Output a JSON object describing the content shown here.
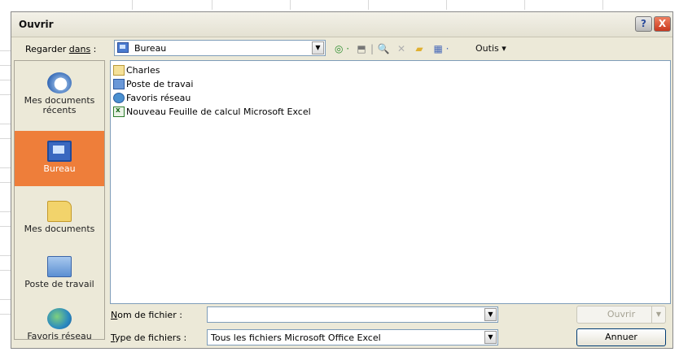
{
  "dialog": {
    "title": "Ouvrir",
    "help_label": "?",
    "close_label": "X"
  },
  "look_in": {
    "label_prefix": "Regarder ",
    "label_accel": "dans",
    "label_suffix": " :",
    "value": "Bureau"
  },
  "toolbar": {
    "back_glyph": "◎ ·",
    "up_glyph": "⬒",
    "separator_glyph": "|",
    "search_glyph": "🔍",
    "delete_glyph": "✕",
    "newfolder_glyph": "▰",
    "views_glyph": "▦ ·",
    "tools_label": "Outis ▾"
  },
  "places": [
    {
      "name": "places-recent",
      "label": "Mes documents récents",
      "icon": "recent-documents-icon",
      "selected": false
    },
    {
      "name": "places-desktop",
      "label": "Bureau",
      "icon": "desktop-icon",
      "selected": true
    },
    {
      "name": "places-my-documents",
      "label": "Mes documents",
      "icon": "my-documents-icon",
      "selected": false
    },
    {
      "name": "places-my-computer",
      "label": "Poste de travail",
      "icon": "my-computer-icon",
      "selected": false
    },
    {
      "name": "places-network",
      "label": "Favoris réseau",
      "icon": "network-places-icon",
      "selected": false
    }
  ],
  "files": [
    {
      "label": "Charles",
      "icon": "folder-icon"
    },
    {
      "label": "Poste de travai",
      "icon": "my-computer-icon"
    },
    {
      "label": "Favoris réseau",
      "icon": "network-places-icon"
    },
    {
      "label": "Nouveau Feuille de calcul Microsoft Excel",
      "icon": "excel-file-icon"
    }
  ],
  "filename": {
    "label_accel": "N",
    "label_rest": "om de fichier :",
    "value": ""
  },
  "filetype": {
    "label_accel": "T",
    "label_rest": "ype de fichiers :",
    "value": "Tous les fichiers Microsoft Office Excel"
  },
  "buttons": {
    "open_label": "Ouvrir",
    "cancel_label": "Annuer"
  }
}
